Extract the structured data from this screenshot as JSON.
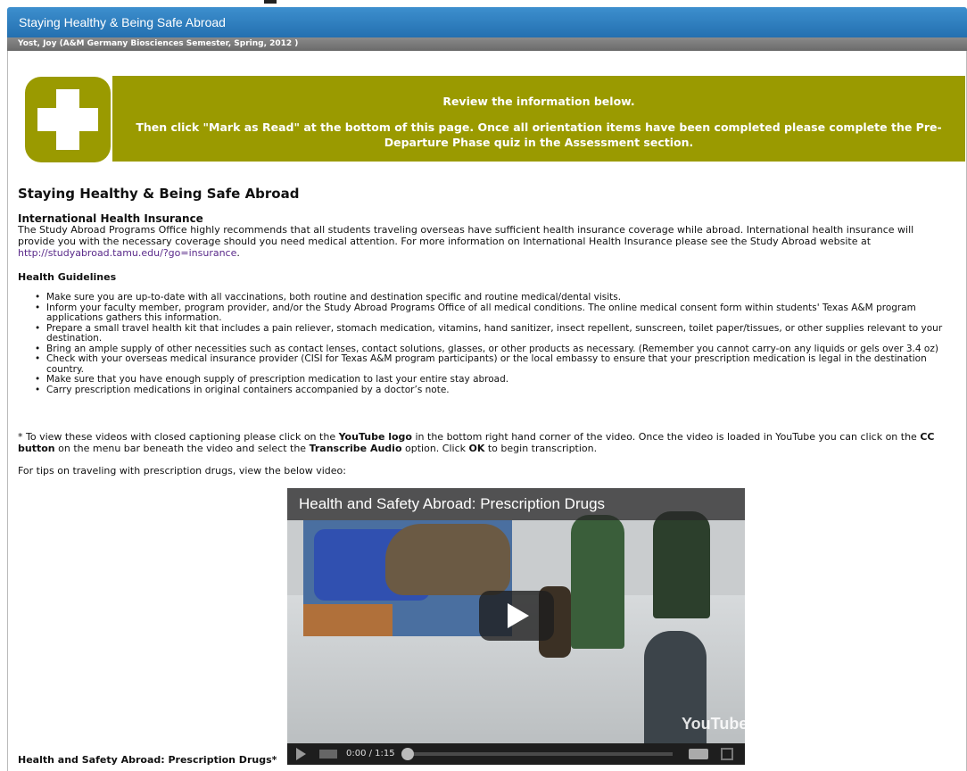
{
  "window": {
    "title": "Staying Healthy & Being Safe Abroad",
    "subtitle": "Yost, Joy (A&M Germany Biosciences Semester, Spring, 2012 )"
  },
  "banner": {
    "line1": "Review the information below.",
    "line2": "Then click \"Mark as Read\" at the bottom of this page. Once all orientation items have been completed please complete the Pre-Departure Phase quiz in the Assessment section.",
    "color": "#9a9a00",
    "icon": "plus-icon"
  },
  "main": {
    "title": "Staying Healthy & Being Safe Abroad",
    "insurance": {
      "heading": "International Health Insurance",
      "body": "The Study Abroad Programs Office highly recommends that all students traveling overseas have sufficient health insurance coverage while abroad. International health insurance will provide you with the necessary coverage should you need medical attention.  For more information on International Health Insurance please see the Study Abroad website at",
      "link": "http://studyabroad.tamu.edu/?go=insurance",
      "link_suffix": "."
    },
    "guidelines": {
      "heading": "Health Guidelines",
      "items": [
        "Make sure you are up-to-date with all vaccinations, both routine and destination specific and routine medical/dental visits.",
        "Inform your faculty member, program provider, and/or the Study Abroad Programs Office of all medical conditions. The online medical consent form within students' Texas A&M program applications gathers this information.",
        "Prepare a small travel health kit that includes a pain reliever, stomach medication, vitamins, hand sanitizer, insect repellent, sunscreen, toilet paper/tissues, or other supplies relevant to your destination.",
        "Bring an ample supply of other necessities such as contact lenses, contact solutions, glasses, or other products as necessary. (Remember you cannot carry-on any liquids or gels over 3.4 oz)",
        "Check with your overseas medical insurance provider (CISI for Texas A&M program participants) or the local embassy to ensure that your prescription medication is legal in the destination country.",
        "Make sure that you have enough supply of prescription medication to last your entire stay abroad.",
        "Carry prescription medications in original containers accompanied by a doctor’s note."
      ]
    },
    "caption_note": {
      "part1": "*  To view these videos with closed captioning please click on the ",
      "youtube_logo": "YouTube logo",
      "part2": " in the bottom right hand corner of the video.  Once the video is loaded in YouTube you can click on the ",
      "cc_button": "CC button",
      "part3": " on the menu bar beneath the video and select the ",
      "transcribe": "Transcribe Audio",
      "part4": " option.  Click ",
      "ok": "OK",
      "part5": " to begin transcription."
    },
    "tips": "For tips on traveling with prescription drugs, view the below video:",
    "video": {
      "title": "Health and Safety Abroad: Prescription Drugs",
      "time": "0:00 / 1:15",
      "logo_text": "YouTube",
      "progress": 0
    },
    "video_caption": "Health and Safety Abroad: Prescription Drugs*"
  }
}
